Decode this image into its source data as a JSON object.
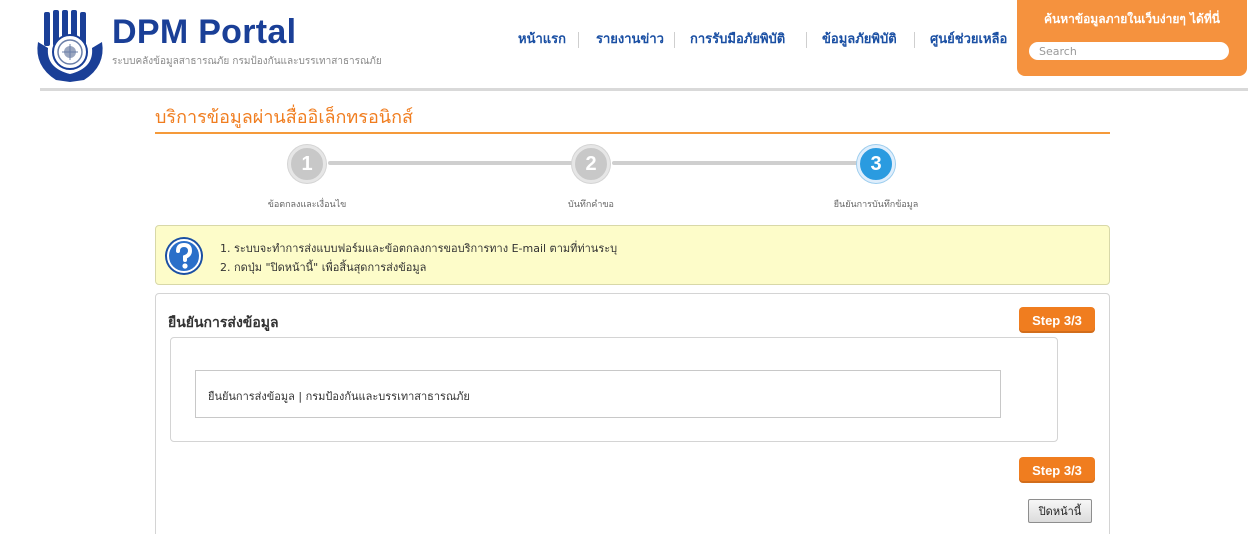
{
  "header": {
    "brand_title": "DPM Portal",
    "brand_subtitle": "ระบบคลังข้อมูลสาธารณภัย กรมป้องกันและบรรเทาสาธารณภัย",
    "brand_color": "#1a3f97",
    "nav": [
      {
        "label": "หน้าแรก"
      },
      {
        "label": "รายงานข่าว"
      },
      {
        "label": "การรับมือภัยพิบัติ"
      },
      {
        "label": "ข้อมูลภัยพิบัติ"
      },
      {
        "label": "ศูนย์ช่วยเหลือ"
      }
    ],
    "search": {
      "title": "ค้นหาข้อมูลภายในเว็บง่ายๆ ได้ที่นี่",
      "placeholder": "Search",
      "panel_color": "#f5923e"
    }
  },
  "page": {
    "title": "บริการข้อมูลผ่านสื่ออิเล็กทรอนิกส์",
    "accent_color": "#f07d1f"
  },
  "steps": [
    {
      "number": "1",
      "label": "ข้อตกลงและเงื่อนไข",
      "active": false
    },
    {
      "number": "2",
      "label": "บันทึกคำขอ",
      "active": false
    },
    {
      "number": "3",
      "label": "ยืนยันการบันทึกข้อมูล",
      "active": true
    }
  ],
  "info": {
    "icon": "question-mark-icon",
    "lines": [
      "1.  ระบบจะทำการส่งแบบฟอร์มและข้อตกลงการขอบริการทาง E-mail ตามที่ท่านระบุ",
      "2.  กดปุ่ม \"ปิดหน้านี้\" เพื่อสิ้นสุดการส่งข้อมูล"
    ],
    "background": "#fdfcc9"
  },
  "panel": {
    "title": "ยืนยันการส่งข้อมูล",
    "step_badge_top": "Step 3/3",
    "step_badge_bottom": "Step 3/3",
    "confirm_text": "ยืนยันการส่งข้อมูล | กรมป้องกันและบรรเทาสาธารณภัย",
    "close_button_label": "ปิดหน้านี้"
  }
}
